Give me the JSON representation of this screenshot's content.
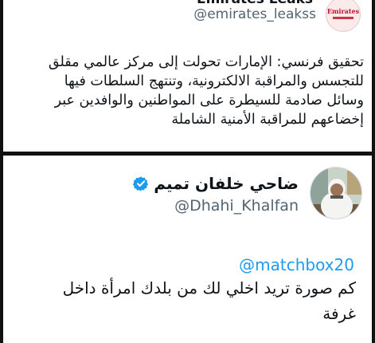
{
  "top_tweet": {
    "display_name": "Emirates Leaks",
    "handle": "@emirates_leakss",
    "avatar_logo_text": "Emirates",
    "body_lines": [
      "تحقيق فرنسي: الإمارات تحولت إلى مركز عالمي مقلق",
      "للتجسس والمراقبة الالكترونية، وتنتهج السلطات فيها",
      "وسائل صادمة للسيطرة على المواطنين والوافدين عبر",
      "إخضاعهم للمراقبة الأمنية الشاملة"
    ]
  },
  "bottom_tweet": {
    "display_name": "ضاحي خلفان تميم",
    "verified_icon": "verified-badge-icon",
    "handle": "@Dhahi_Khalfan",
    "reply_to": "@matchbox20",
    "body_lines": [
      "كم صورة تريد اخلي لك من بلدك امرأة داخل",
      "غرفة"
    ]
  },
  "colors": {
    "background": "#111111",
    "card": "#ffffff",
    "text": "#0f1419",
    "muted": "#536471",
    "link": "#1d9bf0",
    "brand_red": "#c8102e"
  }
}
